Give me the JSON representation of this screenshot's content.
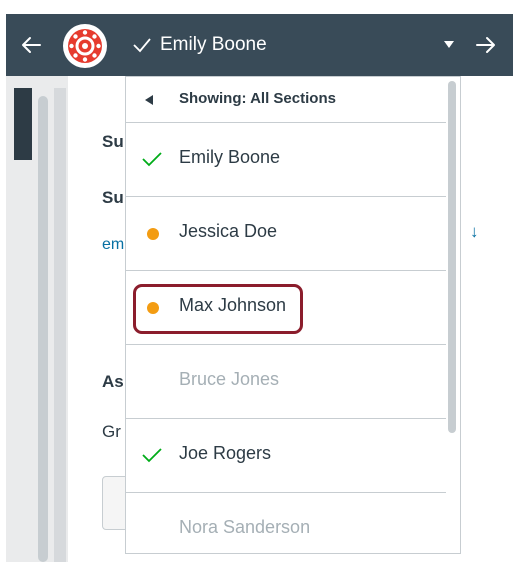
{
  "header": {
    "student_name": "Emily Boone",
    "icons": [
      "back-arrow-icon",
      "canvas-logo-icon",
      "check-icon",
      "caret-down-icon",
      "forward-arrow-icon"
    ]
  },
  "background": {
    "label1": "Su",
    "label2": "Su",
    "link": "em",
    "label3": "As",
    "label4": "Gr",
    "download_arrow": "↓"
  },
  "dropdown": {
    "title": "Showing: All Sections",
    "students": [
      {
        "name": "Emily Boone",
        "status": "graded"
      },
      {
        "name": "Jessica Doe",
        "status": "needs-grading"
      },
      {
        "name": "Max Johnson",
        "status": "needs-grading"
      },
      {
        "name": "Bruce Jones",
        "status": "no-submission"
      },
      {
        "name": "Joe Rogers",
        "status": "graded"
      },
      {
        "name": "Nora Sanderson",
        "status": "no-submission"
      }
    ]
  },
  "colors": {
    "header_bg": "#394b58",
    "check_green": "#00ac18",
    "needs_grading_orange": "#f39c12",
    "highlight_border": "#8b1d2c",
    "muted_text": "#a5afb5"
  }
}
